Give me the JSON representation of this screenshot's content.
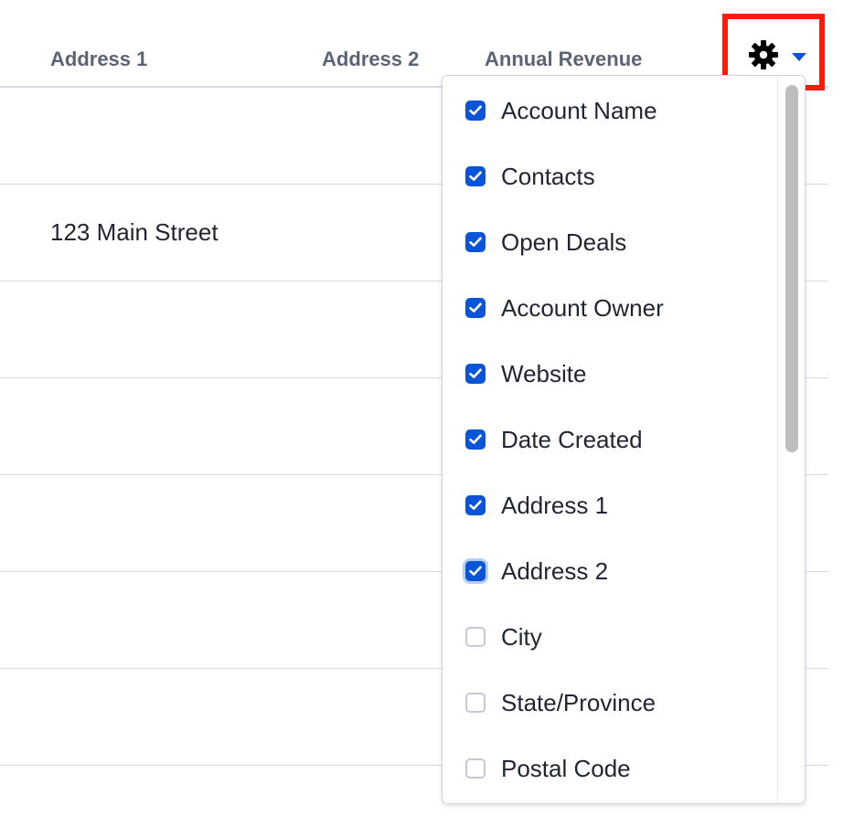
{
  "table": {
    "headers": {
      "address1": "Address 1",
      "address2": "Address 2",
      "annual_revenue": "Annual Revenue"
    },
    "rows": [
      {
        "address1": ""
      },
      {
        "address1": "123 Main Street"
      },
      {
        "address1": ""
      },
      {
        "address1": ""
      },
      {
        "address1": ""
      },
      {
        "address1": ""
      },
      {
        "address1": ""
      }
    ]
  },
  "settings": {
    "icon": "gear-icon",
    "highlight_color": "#ff1a0b",
    "caret_color": "#0a54d8"
  },
  "column_menu": {
    "items": [
      {
        "label": "Account Name",
        "checked": true
      },
      {
        "label": "Contacts",
        "checked": true
      },
      {
        "label": "Open Deals",
        "checked": true
      },
      {
        "label": "Account Owner",
        "checked": true
      },
      {
        "label": "Website",
        "checked": true
      },
      {
        "label": "Date Created",
        "checked": true
      },
      {
        "label": "Address 1",
        "checked": true
      },
      {
        "label": "Address 2",
        "checked": true
      },
      {
        "label": "City",
        "checked": false
      },
      {
        "label": "State/Province",
        "checked": false
      },
      {
        "label": "Postal Code",
        "checked": false
      }
    ],
    "accent_color": "#0a54d8"
  }
}
